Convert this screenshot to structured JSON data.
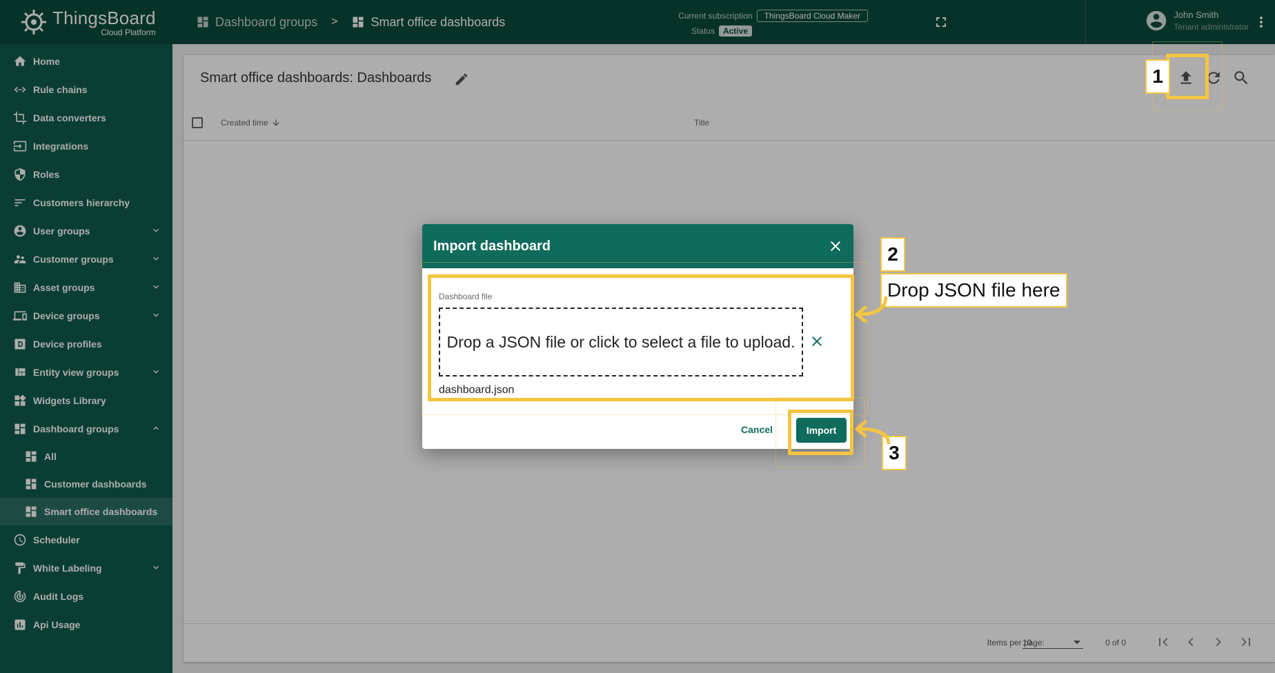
{
  "brand": {
    "title": "ThingsBoard",
    "subtitle": "Cloud Platform"
  },
  "sidebar": {
    "items": [
      {
        "label": "Home",
        "icon": "home-icon"
      },
      {
        "label": "Rule chains",
        "icon": "rule-chains-icon"
      },
      {
        "label": "Data converters",
        "icon": "crop-icon"
      },
      {
        "label": "Integrations",
        "icon": "input-icon"
      },
      {
        "label": "Roles",
        "icon": "shield-icon"
      },
      {
        "label": "Customers hierarchy",
        "icon": "sort-icon"
      },
      {
        "label": "User groups",
        "icon": "account-circle-icon"
      },
      {
        "label": "Customer groups",
        "icon": "supervisor-icon"
      },
      {
        "label": "Asset groups",
        "icon": "domain-icon"
      },
      {
        "label": "Device groups",
        "icon": "devices-icon"
      },
      {
        "label": "Device profiles",
        "icon": "device-profile-icon"
      },
      {
        "label": "Entity view groups",
        "icon": "view-quilt-icon"
      },
      {
        "label": "Widgets Library",
        "icon": "widgets-icon"
      },
      {
        "label": "Dashboard groups",
        "icon": "dashboard-icon"
      },
      {
        "label": "All",
        "icon": "dashboard-icon"
      },
      {
        "label": "Customer dashboards",
        "icon": "dashboard-icon"
      },
      {
        "label": "Smart office dashboards",
        "icon": "dashboard-icon"
      },
      {
        "label": "Scheduler",
        "icon": "schedule-icon"
      },
      {
        "label": "White Labeling",
        "icon": "format-paint-icon"
      },
      {
        "label": "Audit Logs",
        "icon": "track-changes-icon"
      },
      {
        "label": "Api Usage",
        "icon": "insert-chart-icon"
      }
    ]
  },
  "topbar": {
    "breadcrumb": [
      "Dashboard groups",
      "Smart office dashboards"
    ],
    "separator": ">",
    "subscription_label": "Current subscription",
    "subscription_plan": "ThingsBoard Cloud Maker",
    "status_label": "Status",
    "status_value": "Active",
    "user_name": "John Smith",
    "user_role": "Tenant administrator"
  },
  "main": {
    "title": "Smart office dashboards: Dashboards",
    "columns": {
      "created": "Created time",
      "title": "Title"
    },
    "paginator": {
      "items_per_page_label": "Items per page:",
      "items_per_page": "10",
      "range": "0 of 0"
    }
  },
  "dialog": {
    "title": "Import dashboard",
    "field_label": "Dashboard file",
    "dropzone_text": "Drop a JSON file or click to select a file to upload.",
    "filename": "dashboard.json",
    "cancel": "Cancel",
    "import": "Import"
  },
  "callouts": {
    "step1": "1",
    "step2": "2",
    "step2_text": "Drop JSON file here",
    "step3": "3"
  },
  "colors": {
    "primary": "#0f6b5c",
    "sidebar": "#0f5c4f",
    "highlight": "#f4c542"
  }
}
